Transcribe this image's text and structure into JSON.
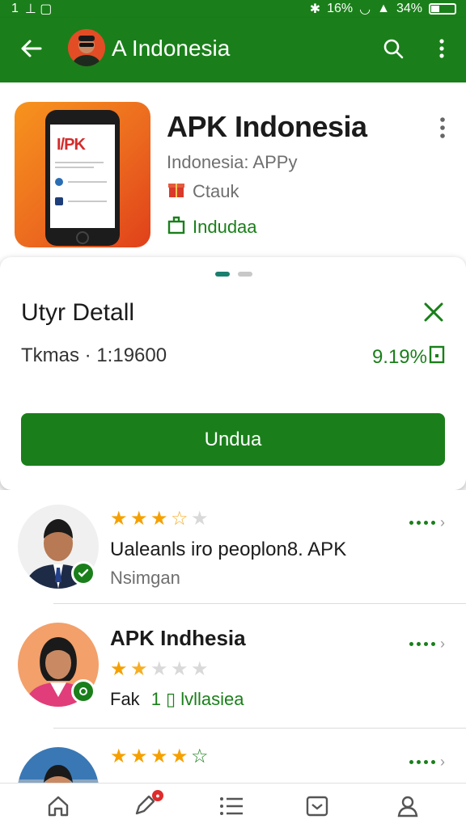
{
  "status_bar": {
    "left_text": "1",
    "time_icons": "⊥ ▢",
    "battery": "34%",
    "signal": "16%"
  },
  "app_bar": {
    "title": "A Indonesia"
  },
  "app_header": {
    "title": "APK Indonesia",
    "subtitle": "Indonesia: APPy",
    "category": "Ctauk",
    "install": "Indudaa",
    "icon_text": "I/PK"
  },
  "sheet": {
    "title": "Utyr Detall",
    "info": "Tkmas · 1:19600",
    "percent": "9.19%",
    "button_label": "Undua"
  },
  "reviews": [
    {
      "stars": [
        "full",
        "full",
        "full",
        "half",
        "empty"
      ],
      "name": "Ualeanls iro peoplon8. APK",
      "meta": "Nsimgan"
    },
    {
      "name": "APK Indhesia",
      "stars": [
        "full",
        "half",
        "empty",
        "empty",
        "empty"
      ],
      "meta_left": "Fak",
      "meta_right": "1 ▯ lvllasiea"
    },
    {
      "stars": [
        "full",
        "full",
        "full",
        "full",
        "outline"
      ]
    }
  ],
  "colors": {
    "brand_green": "#1a7f1a",
    "star": "#f5a000",
    "icon_orange": "#f7941d"
  }
}
